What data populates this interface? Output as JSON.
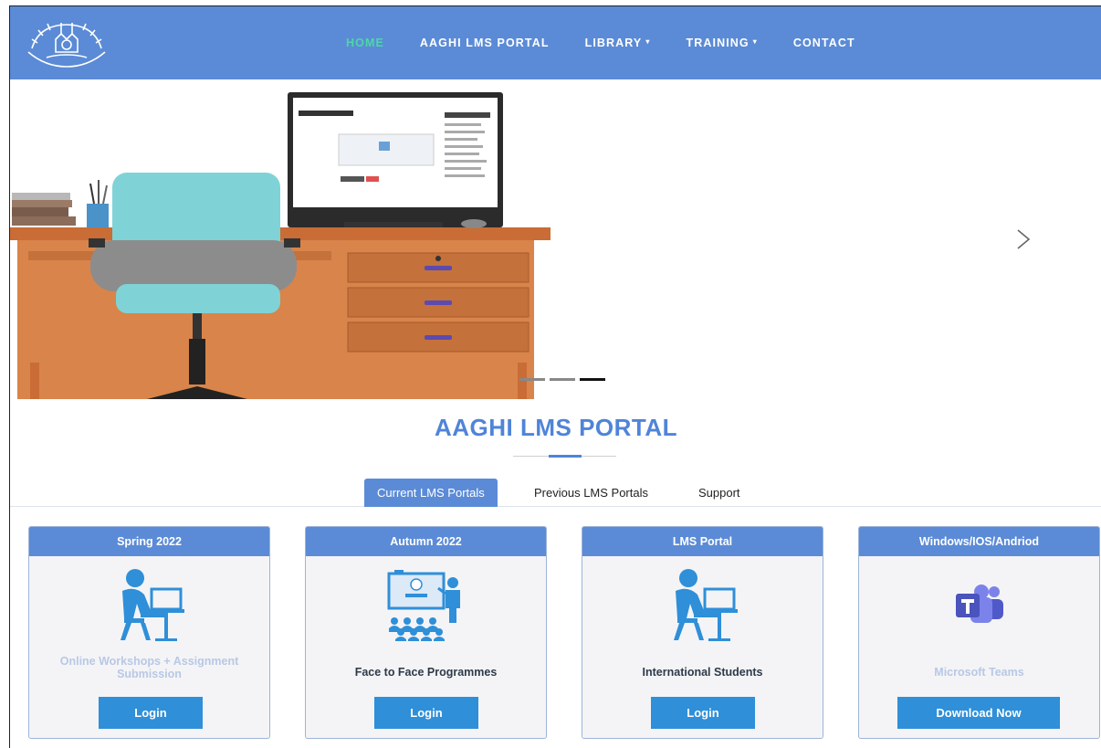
{
  "nav": {
    "logo_icon": "university-crest-logo",
    "items": [
      {
        "label": "HOME",
        "active": true
      },
      {
        "label": "AAGHI LMS PORTAL"
      },
      {
        "label": "LIBRARY",
        "caret": "▾"
      },
      {
        "label": "TRAINING",
        "caret": "▾"
      },
      {
        "label": "CONTACT"
      }
    ]
  },
  "hero": {
    "slide_illustration": "desk-computer-chair-illustration",
    "next_icon": "chevron-right-icon",
    "indicator_count": 3,
    "active_indicator": 3
  },
  "portal": {
    "title": "AAGHI LMS PORTAL",
    "tabs": [
      {
        "label": "Current LMS Portals",
        "active": true
      },
      {
        "label": "Previous LMS Portals"
      },
      {
        "label": "Support"
      }
    ],
    "cards": [
      {
        "header": "Spring 2022",
        "icon": "student-at-laptop-icon",
        "text": "Online Workshops + Assignment Submission",
        "button": "Login"
      },
      {
        "header": "Autumn 2022",
        "icon": "classroom-presentation-icon",
        "text": "Face to Face Programmes",
        "button": "Login"
      },
      {
        "header": "LMS Portal",
        "icon": "student-at-laptop-icon",
        "text": "International Students",
        "button": "Login"
      },
      {
        "header": "Windows/IOS/Andriod",
        "icon": "microsoft-teams-icon",
        "text": "Microsoft Teams",
        "button": "Download Now"
      }
    ]
  },
  "colors": {
    "nav_bg": "#5b8bd6",
    "nav_active": "#4ed6a8",
    "title": "#4f84d8",
    "button": "#2f8fd8"
  }
}
